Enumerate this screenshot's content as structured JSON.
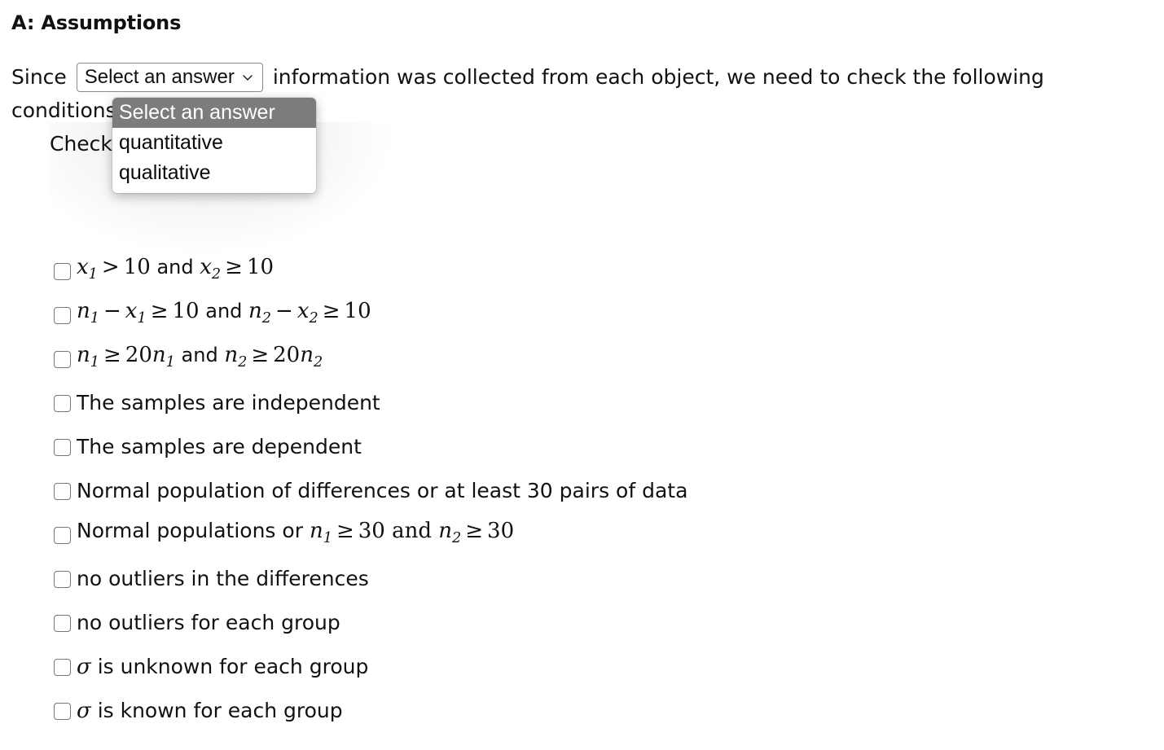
{
  "heading": "A: Assumptions",
  "intro": {
    "before_select": "Since",
    "after_select": "information was collected from each object, we need to check the following",
    "line2": "conditions",
    "line3": "Check all that apply"
  },
  "select": {
    "name": "data-type-select",
    "value": "Select an answer",
    "chevron_icon": "chevron-down-icon",
    "expanded": true,
    "options": [
      {
        "label": "Select an answer",
        "selected": true
      },
      {
        "label": "quantitative",
        "selected": false
      },
      {
        "label": "qualitative",
        "selected": false
      }
    ]
  },
  "assumptions": [
    {
      "id": "cond-x1-x2",
      "type": "math",
      "checked": false,
      "parts": [
        {
          "t": "var",
          "v": "x",
          "sub": "1"
        },
        {
          "t": "op",
          "v": ">"
        },
        {
          "t": "num",
          "v": "10"
        },
        {
          "t": "word",
          "v": "and"
        },
        {
          "t": "var",
          "v": "x",
          "sub": "2"
        },
        {
          "t": "op",
          "v": "≥"
        },
        {
          "t": "num",
          "v": "10"
        }
      ],
      "text": "x1 > 10 and x2 ≥ 10"
    },
    {
      "id": "cond-n1-minus-x1",
      "type": "math",
      "checked": false,
      "parts": [
        {
          "t": "var",
          "v": "n",
          "sub": "1"
        },
        {
          "t": "op",
          "v": "−"
        },
        {
          "t": "var",
          "v": "x",
          "sub": "1"
        },
        {
          "t": "op",
          "v": "≥"
        },
        {
          "t": "num",
          "v": "10"
        },
        {
          "t": "word",
          "v": "and"
        },
        {
          "t": "var",
          "v": "n",
          "sub": "2"
        },
        {
          "t": "op",
          "v": "−"
        },
        {
          "t": "var",
          "v": "x",
          "sub": "2"
        },
        {
          "t": "op",
          "v": "≥"
        },
        {
          "t": "num",
          "v": "10"
        }
      ],
      "text": "n1 − x1 ≥ 10 and n2 − x2 ≥ 10"
    },
    {
      "id": "cond-n1-20n1",
      "type": "math",
      "checked": false,
      "parts": [
        {
          "t": "var",
          "v": "n",
          "sub": "1"
        },
        {
          "t": "op",
          "v": "≥"
        },
        {
          "t": "num",
          "v": "20"
        },
        {
          "t": "var",
          "v": "n",
          "sub": "1"
        },
        {
          "t": "word",
          "v": "and"
        },
        {
          "t": "var",
          "v": "n",
          "sub": "2"
        },
        {
          "t": "op",
          "v": "≥"
        },
        {
          "t": "num",
          "v": "20"
        },
        {
          "t": "var",
          "v": "n",
          "sub": "2"
        }
      ],
      "text": "n1 ≥ 20n1 and n2 ≥ 20n2"
    },
    {
      "id": "cond-independent",
      "type": "text",
      "checked": false,
      "text": "The samples are independent"
    },
    {
      "id": "cond-dependent",
      "type": "text",
      "checked": false,
      "text": "The samples are dependent"
    },
    {
      "id": "cond-normal-differences",
      "type": "text",
      "checked": false,
      "text": "Normal population of differences or at least 30 pairs of data"
    },
    {
      "id": "cond-normal-populations",
      "type": "mixed",
      "checked": false,
      "lead": "Normal populations or",
      "parts": [
        {
          "t": "var",
          "v": "n",
          "sub": "1"
        },
        {
          "t": "op",
          "v": "≥"
        },
        {
          "t": "num",
          "v": "30"
        },
        {
          "t": "word",
          "v": "and"
        },
        {
          "t": "var",
          "v": "n",
          "sub": "2"
        },
        {
          "t": "op",
          "v": "≥"
        },
        {
          "t": "num",
          "v": "30"
        }
      ],
      "text": "Normal populations or n1 ≥ 30 and n2 ≥ 30"
    },
    {
      "id": "cond-no-outliers-differences",
      "type": "text",
      "checked": false,
      "text": "no outliers in the differences"
    },
    {
      "id": "cond-no-outliers-groups",
      "type": "text",
      "checked": false,
      "text": "no outliers for each group"
    },
    {
      "id": "cond-sigma-unknown",
      "type": "sigma",
      "checked": false,
      "symbol": "σ",
      "tail": "is unknown for each group",
      "text": "σ is unknown for each group"
    },
    {
      "id": "cond-sigma-known",
      "type": "sigma",
      "checked": false,
      "symbol": "σ",
      "tail": "is known for each group",
      "text": "σ is known for each group"
    }
  ]
}
